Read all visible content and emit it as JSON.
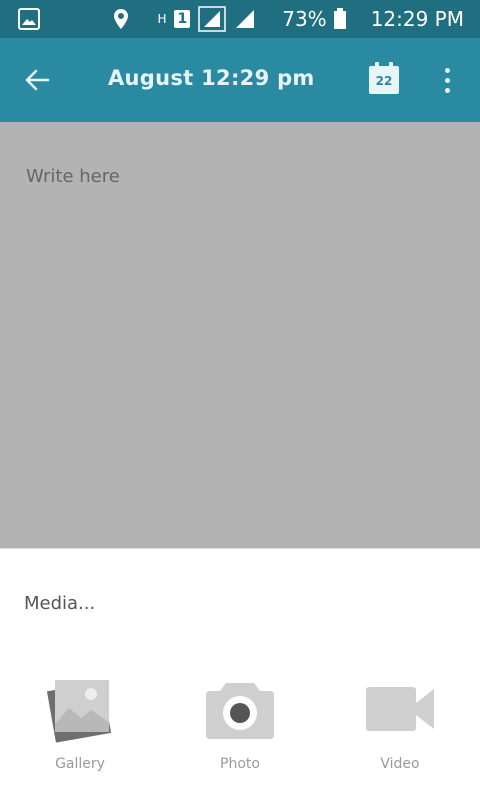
{
  "status_bar": {
    "network_label": "H",
    "sim_label": "1",
    "battery_percent": "73%",
    "time": "12:29 PM"
  },
  "appbar": {
    "title": "August 12:29 pm",
    "calendar_day": "22"
  },
  "editor": {
    "placeholder": "Write here"
  },
  "media_sheet": {
    "title": "Media...",
    "items": [
      {
        "label": "Gallery",
        "icon": "gallery-icon"
      },
      {
        "label": "Photo",
        "icon": "camera-icon"
      },
      {
        "label": "Video",
        "icon": "video-icon"
      }
    ]
  },
  "colors": {
    "status_bar": "#1f6f80",
    "app_bar": "#2a8aa2",
    "editor_bg": "#b3b3b3",
    "icon_gray": "#cfcfcf"
  }
}
